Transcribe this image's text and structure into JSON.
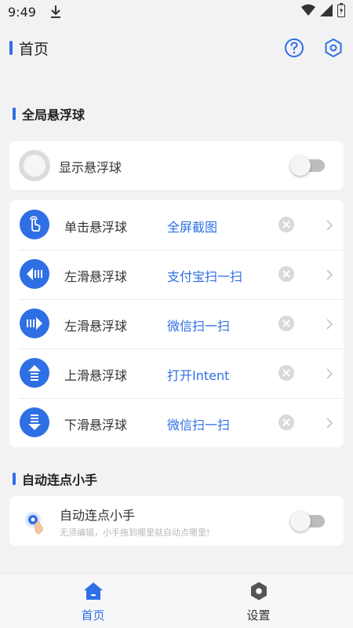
{
  "status_bar": {
    "time": "9:49"
  },
  "header": {
    "title": "首页"
  },
  "sections": {
    "global": "全局悬浮球",
    "auto": "自动连点小手"
  },
  "show_ball": {
    "label": "显示悬浮球",
    "enabled": false
  },
  "gestures": [
    {
      "name": "单击悬浮球",
      "action": "全屏截图",
      "icon": "tap-hand-icon"
    },
    {
      "name": "左滑悬浮球",
      "action": "支付宝扫一扫",
      "icon": "arrow-left-icon"
    },
    {
      "name": "左滑悬浮球",
      "action": "微信扫一扫",
      "icon": "arrow-right-icon"
    },
    {
      "name": "上滑悬浮球",
      "action": "打开Intent",
      "icon": "arrow-up-icon"
    },
    {
      "name": "下滑悬浮球",
      "action": "微信扫一扫",
      "icon": "arrow-down-icon"
    }
  ],
  "auto_clicker": {
    "title": "自动连点小手",
    "subtitle": "无须编辑，小手拖到哪里就自动点哪里!",
    "enabled": false
  },
  "bottom_nav": {
    "home": "首页",
    "settings": "设置"
  },
  "colors": {
    "accent": "#2f6fe4",
    "background": "#f2f2f5"
  }
}
